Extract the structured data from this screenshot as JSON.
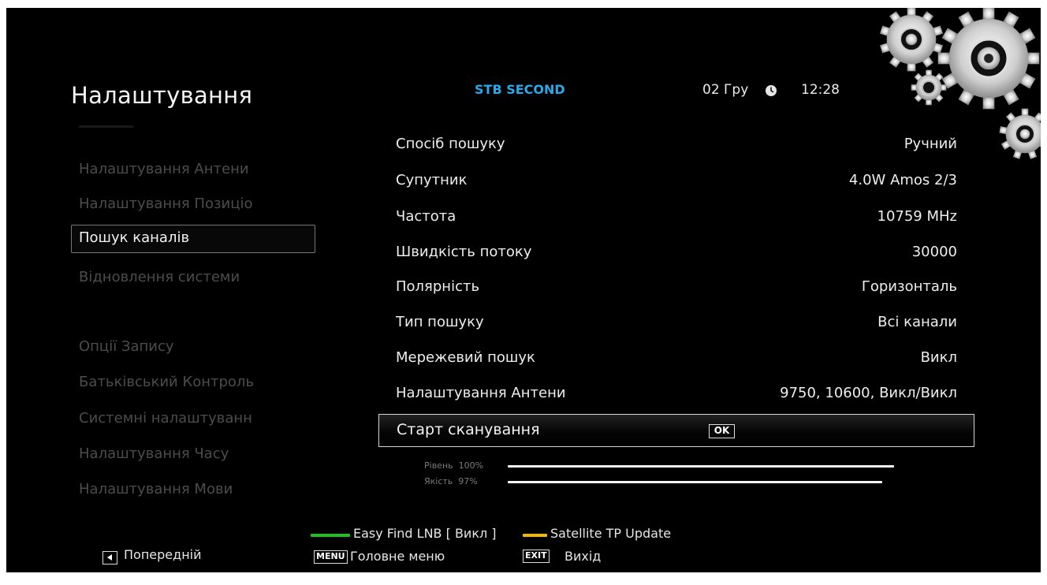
{
  "header": {
    "title": "Налаштування",
    "device": "STB SECOND",
    "date": "02 Гру",
    "time": "12:28"
  },
  "sidebar": {
    "items": [
      {
        "label": "Налаштування Антени",
        "state": "inactive"
      },
      {
        "label": "Налаштування Позиціо",
        "state": "inactive"
      },
      {
        "label": "Пошук каналів",
        "state": "selected"
      },
      {
        "label": "Відновлення системи",
        "state": "inactive"
      },
      {
        "label": "Опції Запису",
        "state": "inactive"
      },
      {
        "label": "Батьківський Контроль",
        "state": "inactive"
      },
      {
        "label": "Системні налаштуванн",
        "state": "inactive"
      },
      {
        "label": "Налаштування Часу",
        "state": "inactive"
      },
      {
        "label": "Налаштування Мови",
        "state": "inactive"
      }
    ]
  },
  "settings": [
    {
      "label": "Спосіб пошуку",
      "value": "Ручний"
    },
    {
      "label": "Супутник",
      "value": "4.0W Amos 2/3"
    },
    {
      "label": "Частота",
      "value": "10759 MHz"
    },
    {
      "label": "Швидкість потоку",
      "value": "30000"
    },
    {
      "label": "Полярність",
      "value": "Горизонталь"
    },
    {
      "label": "Тип пошуку",
      "value": "Всі канали"
    },
    {
      "label": "Мережевий пошук",
      "value": "Викл"
    },
    {
      "label": "Налаштування Антени",
      "value": "9750, 10600, Викл/Викл"
    }
  ],
  "start_scan": {
    "label": "Старт сканування",
    "ok_key": "OK"
  },
  "signal": {
    "level_label": "Рівень",
    "level_value": "100%",
    "level_fraction": 1.0,
    "quality_label": "Якість",
    "quality_value": "97%",
    "quality_fraction": 0.97
  },
  "footer": {
    "green_label": "Easy Find LNB [ Викл ]",
    "yellow_label": "Satellite TP Update",
    "back_label": "Попередній",
    "menu_key": "MENU",
    "menu_label": "Головне меню",
    "exit_key": "EXIT",
    "exit_label": "Вихід"
  },
  "colors": {
    "background": "#000000",
    "accent_blue": "#2aa8e8",
    "green_key": "#1fbf1f",
    "yellow_key": "#f0b800",
    "inactive_text": "#4c4c4c"
  }
}
